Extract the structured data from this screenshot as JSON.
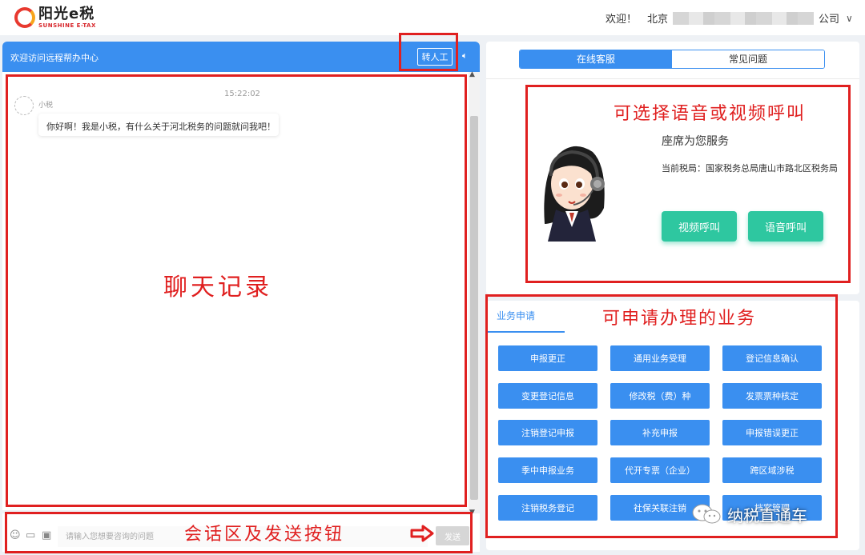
{
  "app": {
    "logo_cn": "阳光e税",
    "logo_en": "SUNSHINE E-TAX",
    "welcome": "欢迎！",
    "company_prefix": "北京",
    "company_suffix": "公司"
  },
  "chat": {
    "header_title": "欢迎访问远程帮办中心",
    "transfer_label": "转人工",
    "timestamp": "15:22:02",
    "sender": "小税",
    "message": "你好啊！我是小税，有什么关于河北税务的问题就问我吧！",
    "annotation": "聊天记录"
  },
  "input": {
    "placeholder": "请输入您想要咨询的问题",
    "send_label": "发送",
    "annotation": "会话区及发送按钮"
  },
  "service": {
    "tabs": [
      {
        "label": "在线客服",
        "active": true
      },
      {
        "label": "常见问题",
        "active": false
      }
    ],
    "title": "座席为您服务",
    "office": "当前税局：国家税务总局唐山市路北区税务局",
    "video_call": "视频呼叫",
    "voice_call": "语音呼叫",
    "annotation": "可选择语音或视频呼叫"
  },
  "business": {
    "tab_label": "业务申请",
    "annotation": "可申请办理的业务",
    "items": [
      "申报更正",
      "通用业务受理",
      "登记信息确认",
      "变更登记信息",
      "修改税（费）种",
      "发票票种核定",
      "注销登记申报",
      "补充申报",
      "申报错误更正",
      "季中申报业务",
      "代开专票（企业）",
      "跨区域涉税",
      "注销税务登记",
      "社保关联注销",
      "档案管理"
    ]
  },
  "watermark": {
    "text": "纳税直通车"
  },
  "colors": {
    "primary": "#3a8ff0",
    "call_green": "#2ec7a0",
    "annotation_red": "#e02020"
  }
}
